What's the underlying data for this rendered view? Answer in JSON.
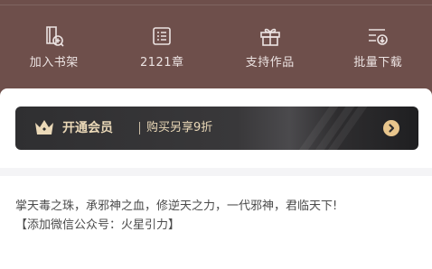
{
  "actions": [
    {
      "label": "加入书架",
      "icon": "bookshelf-add-icon"
    },
    {
      "label": "2121章",
      "icon": "chapter-list-icon"
    },
    {
      "label": "支持作品",
      "icon": "gift-icon"
    },
    {
      "label": "批量下载",
      "icon": "batch-download-icon"
    }
  ],
  "membership": {
    "title": "开通会员",
    "subtitle": "购买另享9折",
    "icon": "crown-icon",
    "arrow_icon": "chevron-right-icon"
  },
  "description": {
    "line1": "掌天毒之珠，承邪神之血，修逆天之力，一代邪神，君临天下!",
    "line2": "【添加微信公众号：火星引力】"
  },
  "colors": {
    "header_bg": "#6e4f4b",
    "member_gold": "#ebd9b8",
    "arrow_gold": "#e8c58c"
  }
}
